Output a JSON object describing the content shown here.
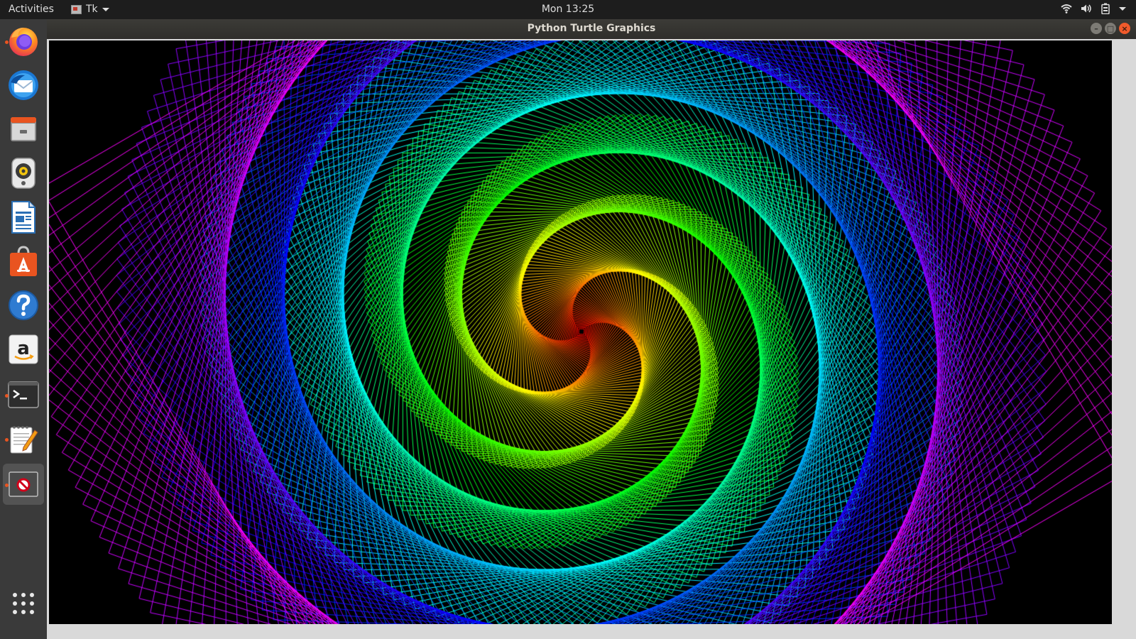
{
  "topbar": {
    "activities_label": "Activities",
    "app_menu_label": "Tk",
    "clock": "Mon 13:25",
    "tray_icons": [
      "wifi-icon",
      "volume-icon",
      "battery-icon",
      "chevron-down-icon"
    ]
  },
  "dock": {
    "items": [
      {
        "name": "firefox",
        "icon": "firefox-icon",
        "running": true
      },
      {
        "name": "thunderbird",
        "icon": "mail-icon",
        "running": false
      },
      {
        "name": "files",
        "icon": "files-icon",
        "running": false
      },
      {
        "name": "rhythmbox",
        "icon": "speaker-icon",
        "running": false
      },
      {
        "name": "writer",
        "icon": "document-icon",
        "running": false
      },
      {
        "name": "software",
        "icon": "shopping-bag-icon",
        "running": false
      },
      {
        "name": "help",
        "icon": "help-icon",
        "running": false
      },
      {
        "name": "amazon",
        "icon": "amazon-icon",
        "running": false
      },
      {
        "name": "terminal",
        "icon": "terminal-icon",
        "running": true
      },
      {
        "name": "text-editor",
        "icon": "notepad-icon",
        "running": true
      },
      {
        "name": "tk-app",
        "icon": "blocked-window-icon",
        "running": true,
        "active": true
      }
    ],
    "show_apps_icon": "app-grid-icon"
  },
  "window": {
    "title": "Python Turtle Graphics",
    "controls": [
      "minimize-icon",
      "maximize-icon",
      "close-icon"
    ]
  },
  "canvas": {
    "background": "#000000",
    "drawing": "spiral of nested rotated squares",
    "palette": [
      "#ff0000",
      "#ff8000",
      "#ffff00",
      "#00ff00",
      "#0000ff",
      "#8000ff",
      "#ff00ff"
    ]
  },
  "colors": {
    "accent": "#e95420",
    "topbar": "#1d1d1d",
    "dock": "#3a3a3a",
    "titlebar": "#3c3b37"
  }
}
